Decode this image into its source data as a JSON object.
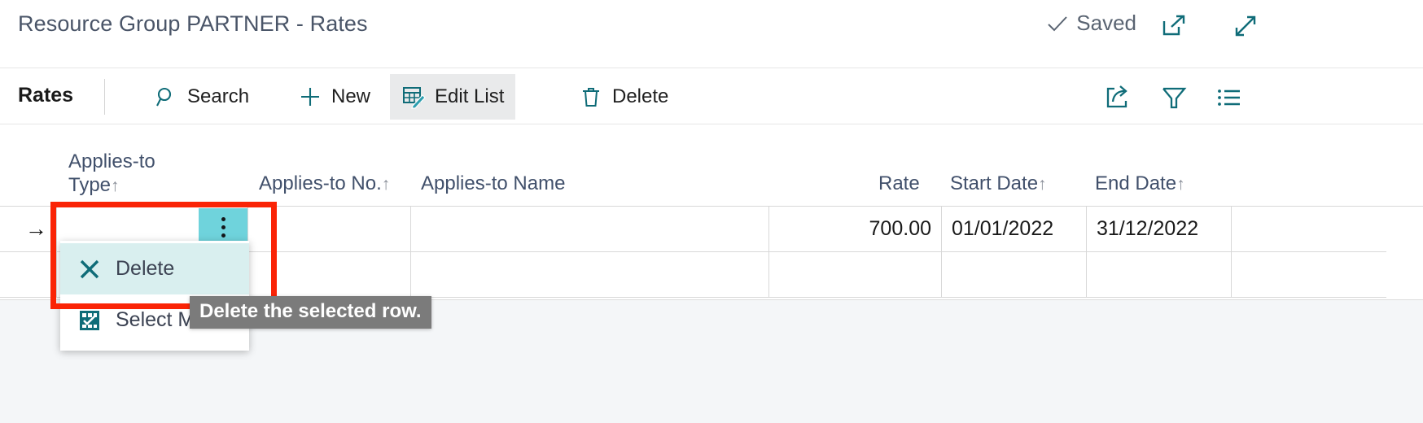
{
  "window": {
    "title": "Resource Group PARTNER - Rates",
    "save_status": "Saved",
    "icons": {
      "saved_check": "check-icon",
      "open_new_window": "open-in-new-window-icon",
      "expand": "expand-fullscreen-icon"
    }
  },
  "toolbar": {
    "group_label": "Rates",
    "actions": [
      {
        "id": "search",
        "label": "Search",
        "icon": "search-icon",
        "active": false
      },
      {
        "id": "new",
        "label": "New",
        "icon": "plus-icon",
        "active": false
      },
      {
        "id": "edit-list",
        "label": "Edit List",
        "icon": "edit-list-icon",
        "active": true
      },
      {
        "id": "delete",
        "label": "Delete",
        "icon": "trash-icon",
        "active": false
      }
    ],
    "right_icons": [
      {
        "id": "share",
        "icon": "share-export-icon"
      },
      {
        "id": "filter",
        "icon": "funnel-filter-icon"
      },
      {
        "id": "list",
        "icon": "list-options-icon"
      }
    ]
  },
  "grid": {
    "columns": [
      {
        "id": "applies-to-type",
        "line1": "Applies-to",
        "line2": "Type",
        "sort": "↑",
        "align": "left"
      },
      {
        "id": "applies-to-no",
        "line1": "",
        "line2": "Applies-to No.",
        "sort": "↑",
        "align": "left"
      },
      {
        "id": "applies-to-name",
        "line1": "",
        "line2": "Applies-to Name",
        "sort": "",
        "align": "left"
      },
      {
        "id": "rate",
        "line1": "",
        "line2": "Rate",
        "sort": "",
        "align": "right"
      },
      {
        "id": "start-date",
        "line1": "",
        "line2": "Start Date",
        "sort": "↑",
        "align": "left"
      },
      {
        "id": "end-date",
        "line1": "",
        "line2": "End Date",
        "sort": "↑",
        "align": "left"
      }
    ],
    "rows": [
      {
        "indicator": "→",
        "applies_to_type": "",
        "applies_to_no": "",
        "applies_to_name": "",
        "rate": "700.00",
        "start_date": "01/01/2022",
        "end_date": "31/12/2022"
      },
      {
        "indicator": "",
        "applies_to_type": "",
        "applies_to_no": "",
        "applies_to_name": "",
        "rate": "",
        "start_date": "",
        "end_date": ""
      }
    ]
  },
  "row_menu": {
    "trigger_icon": "three-dots-vertical-icon",
    "items": [
      {
        "id": "delete",
        "label": "Delete",
        "icon": "x-close-icon",
        "highlighted": true
      },
      {
        "id": "select-more",
        "label": "Select More",
        "icon": "select-more-icon",
        "highlighted": false
      }
    ]
  },
  "tooltip": {
    "text": "Delete the selected row."
  },
  "colors": {
    "accent_teal": "#0f6c78",
    "dots_cyan": "#6fd3dc",
    "menu_highlight": "#d9efef",
    "annotation_red": "#fa2406",
    "tooltip_grey": "#7b7b7b",
    "header_text": "#41506b",
    "toolbar_active_bg": "#e9eaeb"
  }
}
